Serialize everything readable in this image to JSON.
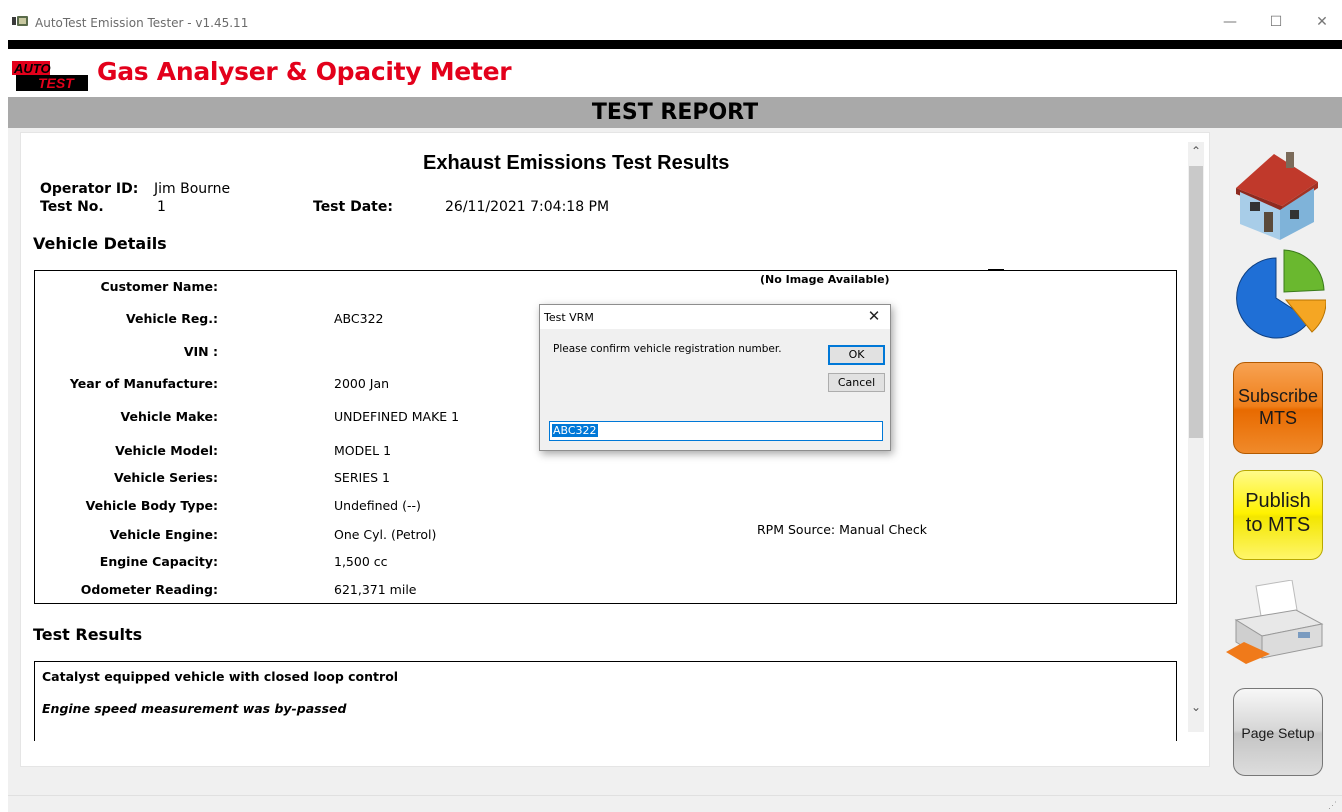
{
  "window": {
    "title": "AutoTest Emission Tester - v1.45.11",
    "minimize": "—",
    "maximize": "☐",
    "close": "✕"
  },
  "header": {
    "logo_top": "AUTO",
    "logo_bottom": "TEST",
    "title": "Gas Analyser & Opacity Meter"
  },
  "report_bar": "TEST REPORT",
  "report": {
    "title": "Exhaust Emissions Test Results",
    "operator_label": "Operator ID:",
    "operator_value": "Jim Bourne",
    "test_no_label": "Test No.",
    "test_no_value": "1",
    "test_date_label": "Test Date:",
    "test_date_value": "26/11/2021 7:04:18 PM",
    "vehicle_details_heading": "Vehicle Details",
    "no_image": "(No Image Available)",
    "rpm_source": "RPM Source: Manual Check",
    "vehicle_fields": [
      {
        "label": "Customer Name:",
        "value": ""
      },
      {
        "label": "Vehicle Reg.:",
        "value": "ABC322"
      },
      {
        "label": "VIN :",
        "value": ""
      },
      {
        "label": "Year of Manufacture:",
        "value": "2000 Jan"
      },
      {
        "label": "Vehicle Make:",
        "value": "UNDEFINED MAKE 1"
      },
      {
        "label": "Vehicle Model:",
        "value": "MODEL 1"
      },
      {
        "label": "Vehicle Series:",
        "value": "SERIES 1"
      },
      {
        "label": "Vehicle Body Type:",
        "value": "Undefined (--)"
      },
      {
        "label": "Vehicle Engine:",
        "value": "One Cyl. (Petrol)"
      },
      {
        "label": "Engine Capacity:",
        "value": "1,500 cc"
      },
      {
        "label": "Odometer Reading:",
        "value": "621,371 mile"
      }
    ],
    "test_results_heading": "Test Results",
    "test_results_lines": [
      "Catalyst equipped vehicle with closed loop control",
      "Engine speed measurement was by-passed"
    ]
  },
  "scrollbar": {
    "up": "⌃",
    "down": "⌄"
  },
  "side_buttons": {
    "home_icon": "home-icon",
    "chart_icon": "pie-chart-icon",
    "subscribe_line1": "Subscribe",
    "subscribe_line2": "MTS",
    "publish_line1": "Publish",
    "publish_line2": "to MTS",
    "print_icon": "printer-icon",
    "page_setup": "Page Setup"
  },
  "dialog": {
    "title": "Test VRM",
    "close": "✕",
    "message": "Please confirm vehicle registration number.",
    "ok_label": "OK",
    "cancel_label": "Cancel",
    "input_value": "ABC322"
  },
  "colors": {
    "brand_red": "#e3001b",
    "report_bar": "#a9a9a9",
    "subscribe": "#ef7f1a",
    "publish": "#fff200",
    "focus_blue": "#0078d7"
  }
}
